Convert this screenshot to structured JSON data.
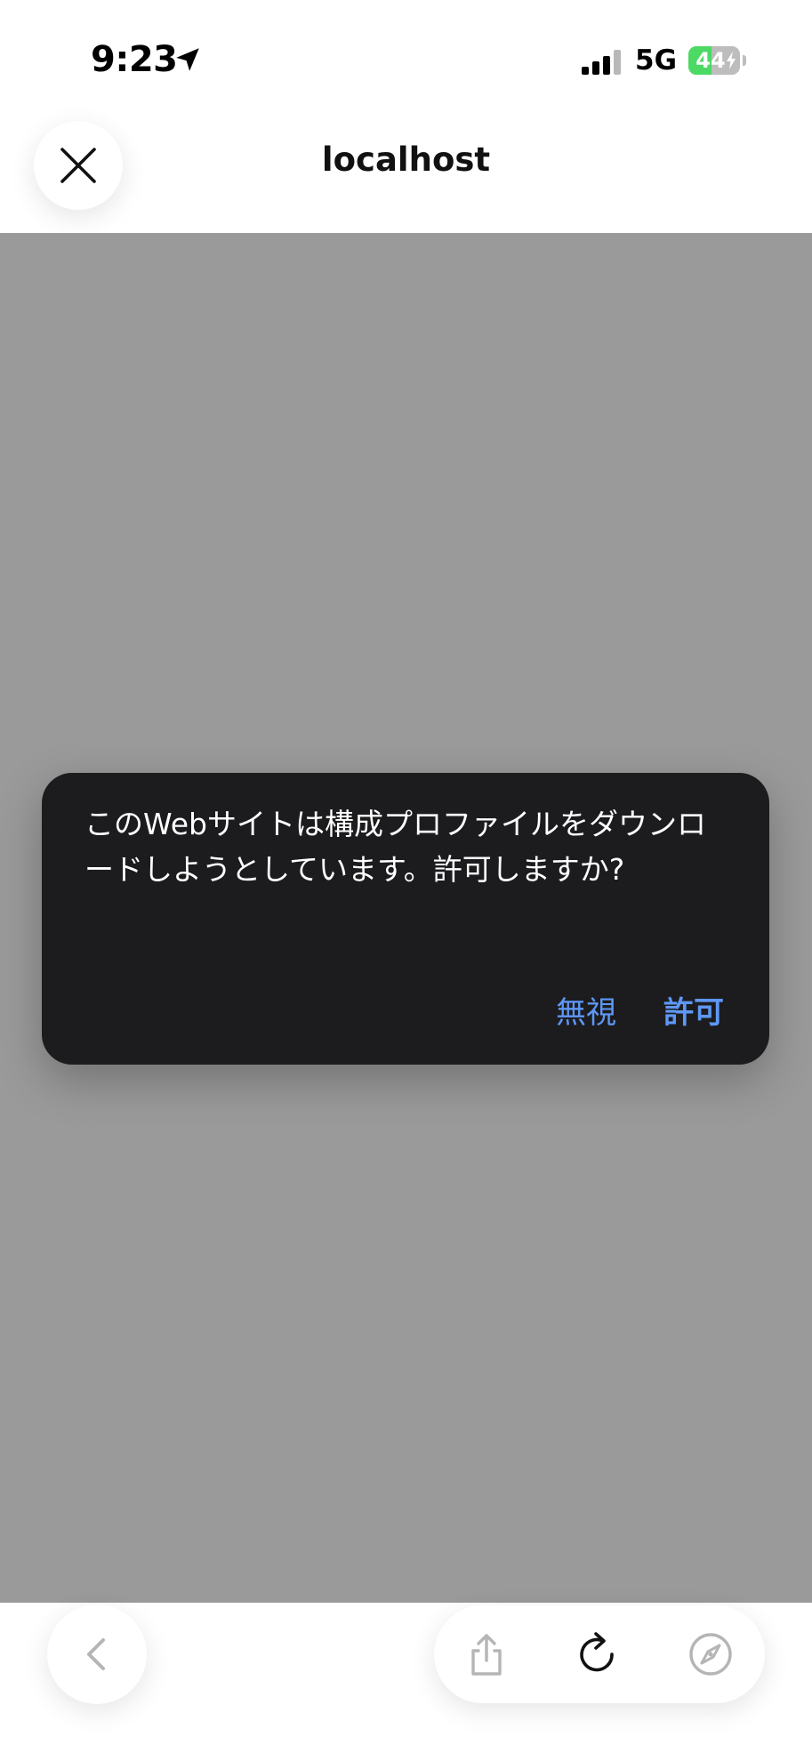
{
  "status_bar": {
    "time": "9:23",
    "network": "5G",
    "battery_text": "44",
    "battery_level": 0.44,
    "icons": [
      "location-arrow-icon",
      "signal-icon",
      "battery-icon",
      "charging-bolt-icon"
    ]
  },
  "header": {
    "title": "localhost",
    "close_icon": "close-icon"
  },
  "dialog": {
    "message": "このWebサイトは構成プロファイルをダウンロードしようとしています。許可しますか?",
    "ignore_label": "無視",
    "allow_label": "許可"
  },
  "toolbar": {
    "icons": [
      "back-chevron-icon",
      "share-icon",
      "reload-icon",
      "compass-icon"
    ]
  },
  "colors": {
    "overlay": "#9a9a9a",
    "dialog_background": "#1c1c1e",
    "dialog_text": "#ffffff",
    "dialog_accent": "#5e97f6",
    "battery_green": "#4cd964",
    "disabled_icon": "#b5b5b5"
  }
}
